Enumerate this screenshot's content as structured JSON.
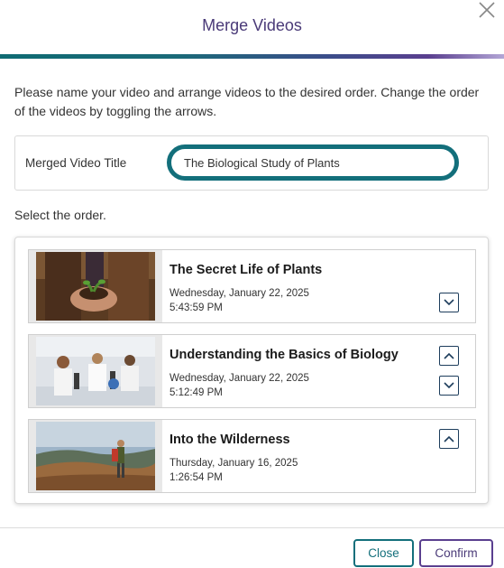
{
  "dialog": {
    "title": "Merge Videos",
    "instructions": "Please name your video and arrange videos to the desired order. Change the order of the videos by toggling the arrows.",
    "title_field_label": "Merged Video Title",
    "title_field_value": "The Biological Study of Plants",
    "select_order_label": "Select the order.",
    "close_label": "Close",
    "confirm_label": "Confirm"
  },
  "videos": [
    {
      "title": "The Secret Life of Plants",
      "date": "Wednesday, January 22, 2025",
      "time": "5:43:59 PM",
      "thumbnail": "hands-holding-soil-seedling"
    },
    {
      "title": "Understanding the Basics of Biology",
      "date": "Wednesday, January 22, 2025",
      "time": "5:12:49 PM",
      "thumbnail": "students-in-lab-with-microscopes"
    },
    {
      "title": "Into the Wilderness",
      "date": "Thursday, January 16, 2025",
      "time": "1:26:54 PM",
      "thumbnail": "hiker-on-hillside-landscape"
    }
  ],
  "colors": {
    "accent_teal": "#136f7b",
    "accent_purple": "#5a3f8f",
    "title_purple": "#4a3a78",
    "arrow_border": "#1d3d5c"
  }
}
